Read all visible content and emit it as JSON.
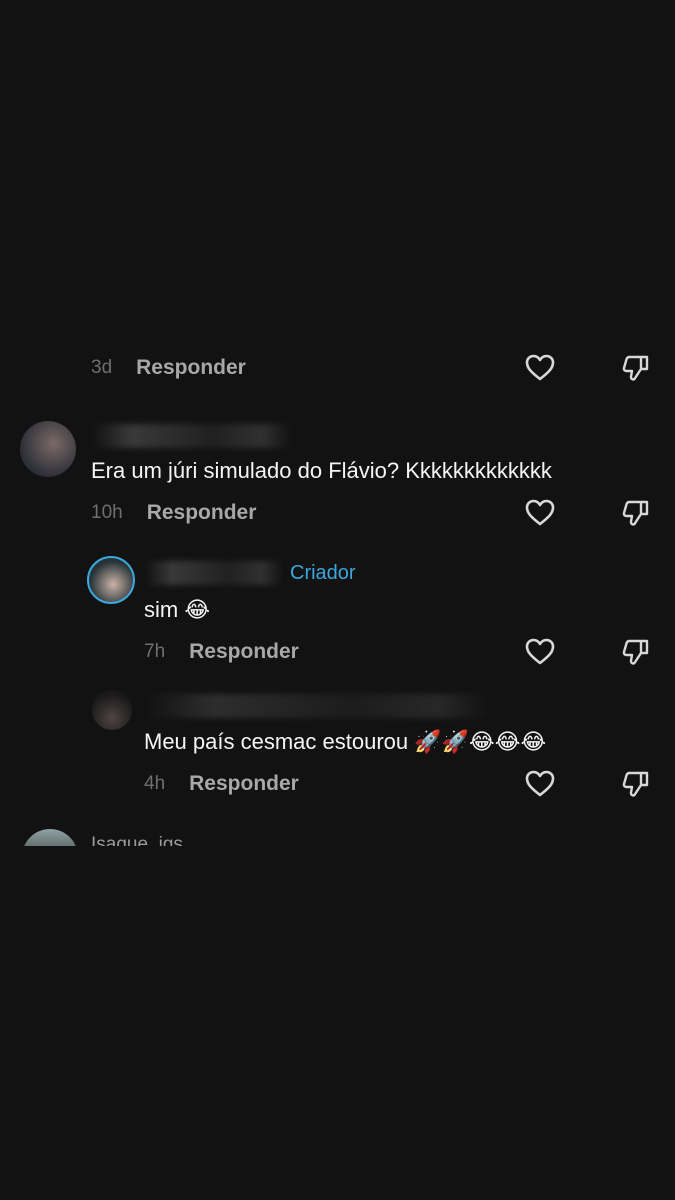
{
  "comments": [
    {
      "time": "3d",
      "reply_label": "Responder"
    },
    {
      "text": "Era um júri simulado do Flávio? Kkkkkkkkkkkkk",
      "time": "10h",
      "reply_label": "Responder"
    },
    {
      "badge": "Criador",
      "text": "sim 😂",
      "time": "7h",
      "reply_label": "Responder"
    },
    {
      "text": "Meu país cesmac estourou 🚀🚀😂😂😂",
      "time": "4h",
      "reply_label": "Responder"
    }
  ],
  "next_comment": {
    "username": "Isaque_igs"
  },
  "colors": {
    "background": "#121212",
    "creator_badge": "#3ba7dd",
    "timestamp": "#6f6f6f",
    "reply": "#a8a8a8"
  },
  "icons": [
    "heart-icon",
    "dislike-icon"
  ]
}
